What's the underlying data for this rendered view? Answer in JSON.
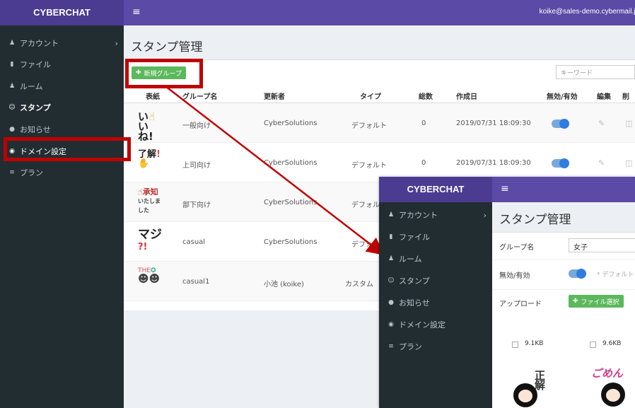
{
  "app": {
    "brand": "CYBERCHAT",
    "user_email": "koike@sales-demo.cybermail.jp",
    "menu_toggle": "≡"
  },
  "sidebar": {
    "items": [
      {
        "icon": "user-icon",
        "label": "アカウント",
        "chevron": "›"
      },
      {
        "icon": "file-icon",
        "label": "ファイル"
      },
      {
        "icon": "users-icon",
        "label": "ルーム"
      },
      {
        "icon": "smile-icon",
        "label": "スタンプ"
      },
      {
        "icon": "bell-icon",
        "label": "お知らせ"
      },
      {
        "icon": "globe-icon",
        "label": "ドメイン設定"
      },
      {
        "icon": "list-icon",
        "label": "プラン"
      }
    ]
  },
  "main": {
    "title": "スタンプ管理",
    "new_group_button": "新規グループ",
    "search_placeholder": "キーワード",
    "columns": [
      "表紙",
      "グループ名",
      "更新者",
      "タイプ",
      "総数",
      "作成日",
      "無効/有効",
      "編集",
      "削除"
    ],
    "rows": [
      {
        "group": "一般向け",
        "updater": "CyberSolutions",
        "type": "デフォルト",
        "count": "0",
        "created": "2019/07/31 18:09:30"
      },
      {
        "group": "上司向け",
        "updater": "CyberSolutions",
        "type": "デフォルト",
        "count": "0",
        "created": "2019/07/31 18:09:30"
      },
      {
        "group": "部下向け",
        "updater": "CyberSolutions",
        "type": "デフォルト",
        "count": "",
        "created": ""
      },
      {
        "group": "casual",
        "updater": "CyberSolutions",
        "type": "デフォルト",
        "count": "",
        "created": ""
      },
      {
        "group": "casual1",
        "updater": "小池 (koike)",
        "type": "カスタム",
        "count": "",
        "created": ""
      }
    ]
  },
  "overlay": {
    "title": "スタンプ管理",
    "group_name_label": "グループ名",
    "group_name_value": "女子",
    "enabled_label": "無効/有効",
    "default_note": "* デフォルト",
    "upload_label": "アップロード",
    "file_select_button": "ファイル選択",
    "files": [
      {
        "size": "9.1KB"
      },
      {
        "size": "9.6KB"
      }
    ],
    "stamp_text": "ごめん",
    "stamp_text2": "正解"
  },
  "colors": {
    "sidebar": "#222d32",
    "brand": "#4b3c92",
    "topbar": "#5b4aa6",
    "accent_red": "#c00000",
    "green": "#5cb85c",
    "toggle": "#2f7de1"
  }
}
